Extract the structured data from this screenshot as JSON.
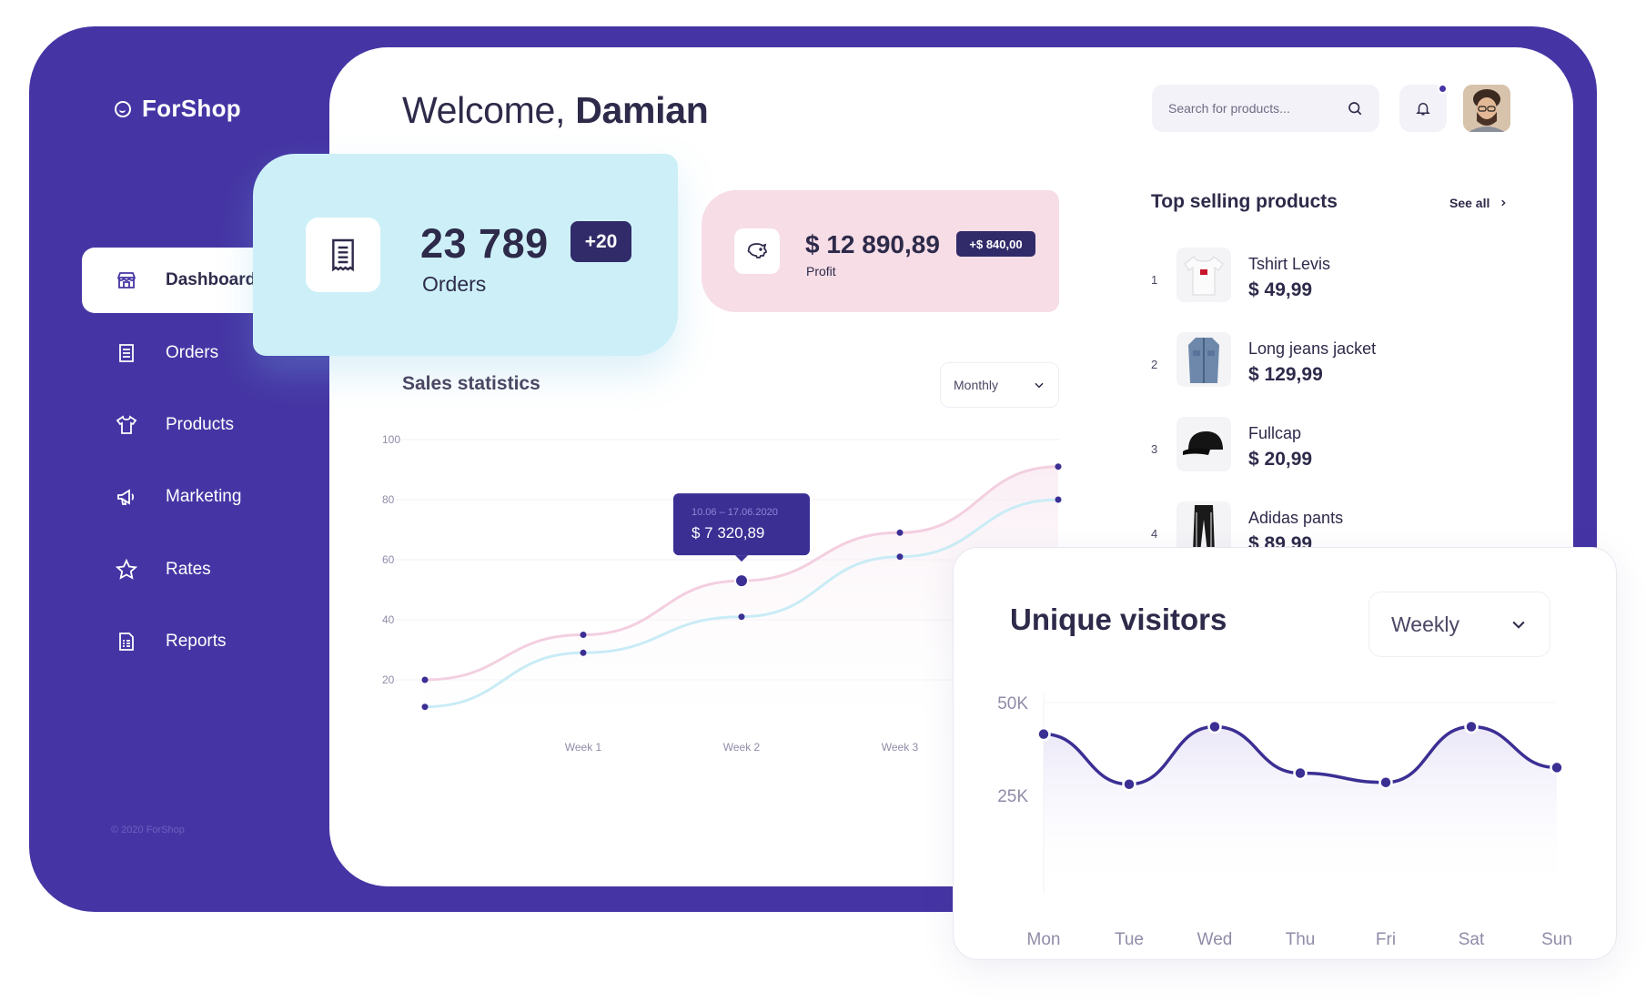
{
  "app": {
    "name": "ForShop",
    "copyright": "© 2020 ForShop"
  },
  "sidebar": {
    "items": [
      {
        "label": "Dashboard",
        "icon": "store-icon",
        "active": true
      },
      {
        "label": "Orders",
        "icon": "receipt-icon",
        "active": false
      },
      {
        "label": "Products",
        "icon": "tshirt-icon",
        "active": false
      },
      {
        "label": "Marketing",
        "icon": "megaphone-icon",
        "active": false
      },
      {
        "label": "Rates",
        "icon": "star-icon",
        "active": false
      },
      {
        "label": "Reports",
        "icon": "report-icon",
        "active": false
      }
    ]
  },
  "header": {
    "welcome_prefix": "Welcome,",
    "user_name": "Damian",
    "search_placeholder": "Search for products..."
  },
  "orders_card": {
    "value": "23 789",
    "label": "Orders",
    "badge": "+20"
  },
  "profit_card": {
    "value": "$ 12 890,89",
    "label": "Profit",
    "badge": "+$ 840,00"
  },
  "sales": {
    "title": "Sales statistics",
    "period": "Monthly",
    "tooltip": {
      "date": "10.06 – 17.06.2020",
      "value": "$ 7 320,89"
    }
  },
  "top_selling": {
    "title": "Top selling products",
    "see_all": "See all",
    "products": [
      {
        "rank": "1",
        "name": "Tshirt Levis",
        "price": "$ 49,99"
      },
      {
        "rank": "2",
        "name": "Long jeans jacket",
        "price": "$ 129,99"
      },
      {
        "rank": "3",
        "name": "Fullcap",
        "price": "$ 20,99"
      },
      {
        "rank": "4",
        "name": "Adidas pants",
        "price": "$ 89,99"
      }
    ]
  },
  "visitors": {
    "title": "Unique visitors",
    "period": "Weekly"
  },
  "colors": {
    "primary": "#4535a4",
    "orders_bg": "#cdf0f8",
    "profit_bg": "#f6dde6",
    "pink_line": "#f3cfe0",
    "blue_line": "#c9ecf6"
  },
  "chart_data": [
    {
      "type": "line",
      "title": "Sales statistics",
      "x_ticks": [
        "Week 1",
        "Week 2",
        "Week 3"
      ],
      "y_ticks": [
        "100",
        "80",
        "60",
        "40",
        "20"
      ],
      "ylim": [
        0,
        100
      ],
      "x": [
        0,
        1,
        2,
        3,
        4
      ],
      "series": [
        {
          "color": "#f3cfe0",
          "values": [
            20,
            35,
            53,
            69,
            91
          ]
        },
        {
          "color": "#c9ecf6",
          "values": [
            11,
            29,
            41,
            61,
            80
          ]
        }
      ],
      "highlight": {
        "index": 2,
        "series": 0
      }
    },
    {
      "type": "area",
      "title": "Unique visitors",
      "categories": [
        "Mon",
        "Tue",
        "Wed",
        "Thu",
        "Fri",
        "Sat",
        "Sun"
      ],
      "y_ticks": [
        "50K",
        "25K"
      ],
      "values": [
        41500,
        28000,
        43500,
        31000,
        28500,
        43500,
        32500
      ]
    }
  ]
}
